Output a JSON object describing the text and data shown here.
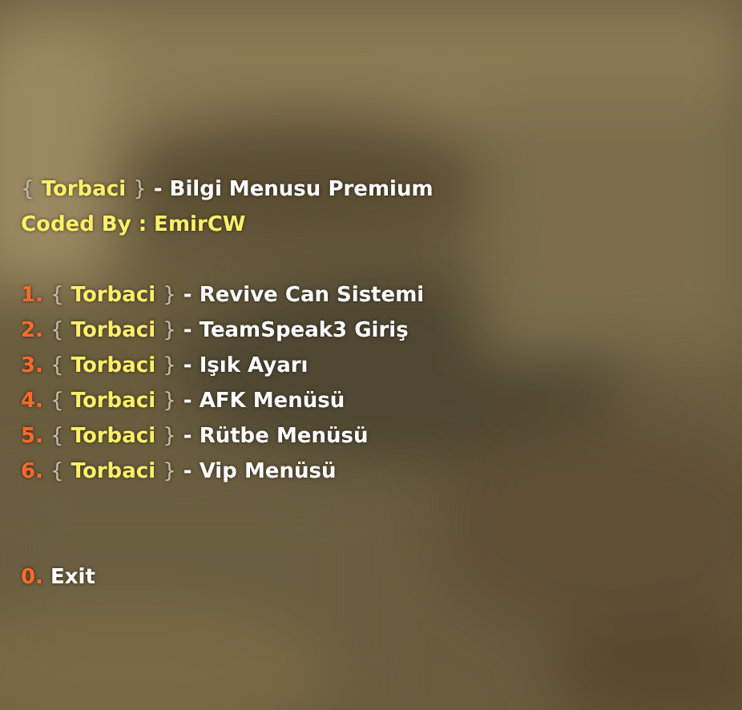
{
  "header": {
    "open": "{",
    "tag": "Torbaci",
    "close": "}",
    "text": "- Bilgi Menusu Premium"
  },
  "credit": "Coded By : EmirCW",
  "items": [
    {
      "key": "1.",
      "open": "{",
      "tag": "Torbaci",
      "close": "}",
      "label": "- Revive Can Sistemi"
    },
    {
      "key": "2.",
      "open": "{",
      "tag": "Torbaci",
      "close": "}",
      "label": "- TeamSpeak3 Giriş"
    },
    {
      "key": "3.",
      "open": "{",
      "tag": "Torbaci",
      "close": "}",
      "label": "- Işık Ayarı"
    },
    {
      "key": "4.",
      "open": "{",
      "tag": "Torbaci",
      "close": "}",
      "label": "- AFK Menüsü"
    },
    {
      "key": "5.",
      "open": "{",
      "tag": "Torbaci",
      "close": "}",
      "label": "- Rütbe Menüsü"
    },
    {
      "key": "6.",
      "open": "{",
      "tag": "Torbaci",
      "close": "}",
      "label": "- Vip Menüsü"
    }
  ],
  "exit": {
    "key": "0.",
    "label": "Exit"
  }
}
